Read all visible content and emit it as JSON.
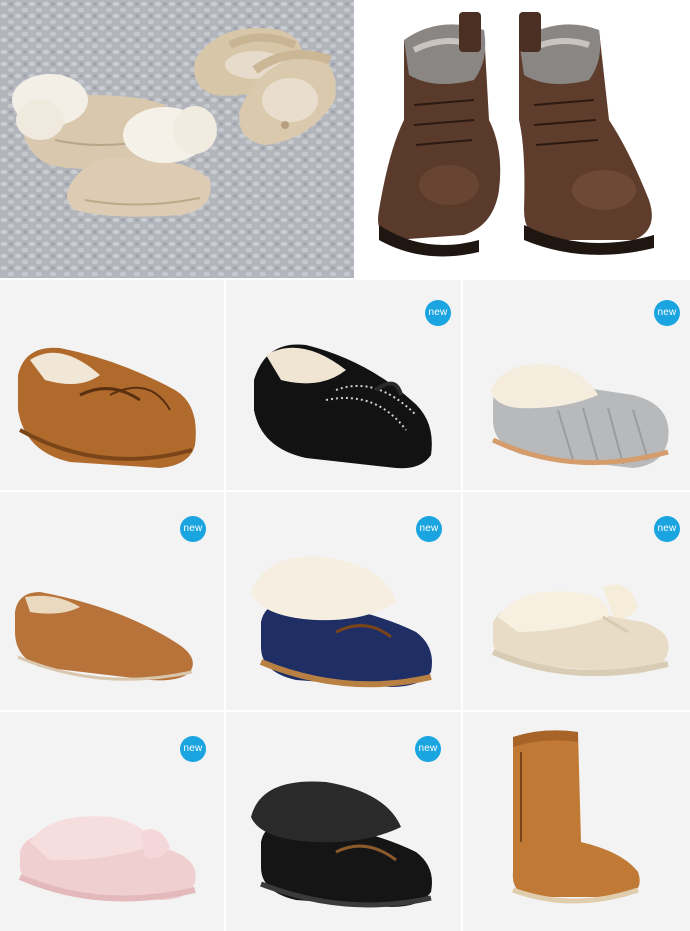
{
  "hero": {
    "left": {
      "subject": "baby-shoes-on-knit-blanket"
    },
    "right": {
      "subject": "brown-leather-lace-up-boots-with-fur-lining"
    }
  },
  "colors": {
    "badge": "#1aa4e0",
    "tile_bg": "#f3f3f4"
  },
  "products": [
    {
      "id": "chestnut-moccasin",
      "badge": ""
    },
    {
      "id": "black-studded-moccasin",
      "badge": "new"
    },
    {
      "id": "grey-knit-slipper",
      "badge": "new"
    },
    {
      "id": "tan-slip-on",
      "badge": "new"
    },
    {
      "id": "navy-collar-moccasin",
      "badge": "new"
    },
    {
      "id": "cream-fur-thong",
      "badge": "new"
    },
    {
      "id": "pink-fur-thong",
      "badge": "new"
    },
    {
      "id": "black-fur-moccasin",
      "badge": "new"
    },
    {
      "id": "chestnut-tall-boot",
      "badge": ""
    }
  ]
}
